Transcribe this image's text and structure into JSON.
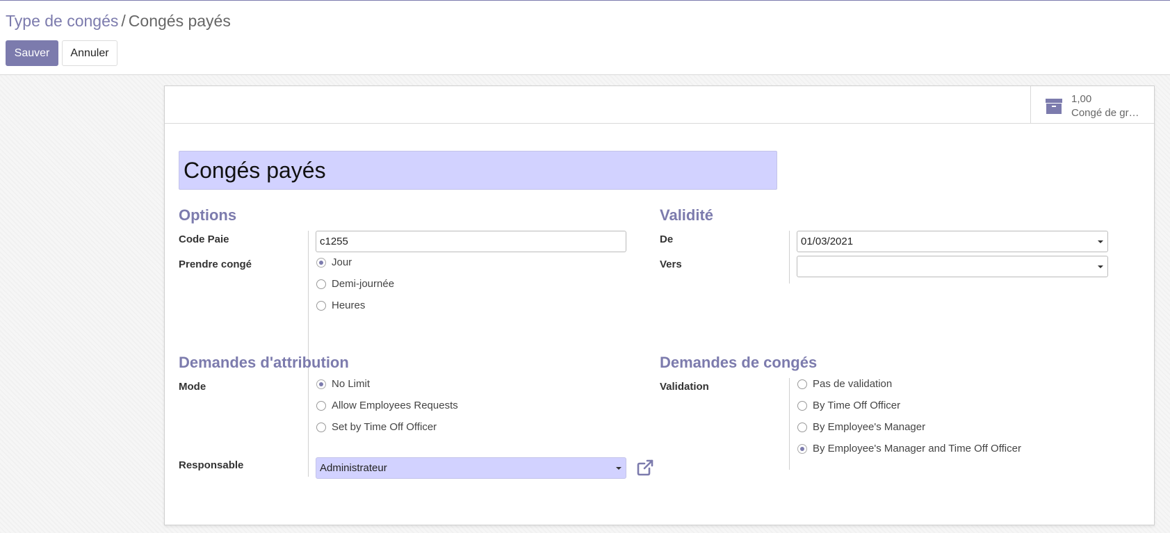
{
  "breadcrumb": {
    "parent": "Type de congés",
    "separator": "/",
    "current": "Congés payés"
  },
  "toolbar": {
    "save_label": "Sauver",
    "cancel_label": "Annuler"
  },
  "stat_button": {
    "value": "1,00",
    "label": "Congé de gr…",
    "icon": "archive-icon"
  },
  "record": {
    "name": "Congés payés"
  },
  "options": {
    "title": "Options",
    "code_label": "Code Paie",
    "code_value": "c1255",
    "take_label": "Prendre congé",
    "take_options": [
      "Jour",
      "Demi-journée",
      "Heures"
    ],
    "take_selected": 0
  },
  "validity": {
    "title": "Validité",
    "from_label": "De",
    "from_value": "01/03/2021",
    "to_label": "Vers",
    "to_value": ""
  },
  "allocation": {
    "title": "Demandes d'attribution",
    "mode_label": "Mode",
    "mode_options": [
      "No Limit",
      "Allow Employees Requests",
      "Set by Time Off Officer"
    ],
    "mode_selected": 0,
    "responsible_label": "Responsable",
    "responsible_value": "Administrateur"
  },
  "leave_requests": {
    "title": "Demandes de congés",
    "validation_label": "Validation",
    "validation_options": [
      "Pas de validation",
      "By Time Off Officer",
      "By Employee's Manager",
      "By Employee's Manager and Time Off Officer"
    ],
    "validation_selected": 3
  },
  "colors": {
    "accent": "#7c7bad",
    "highlight_field": "#d2d2ff"
  }
}
